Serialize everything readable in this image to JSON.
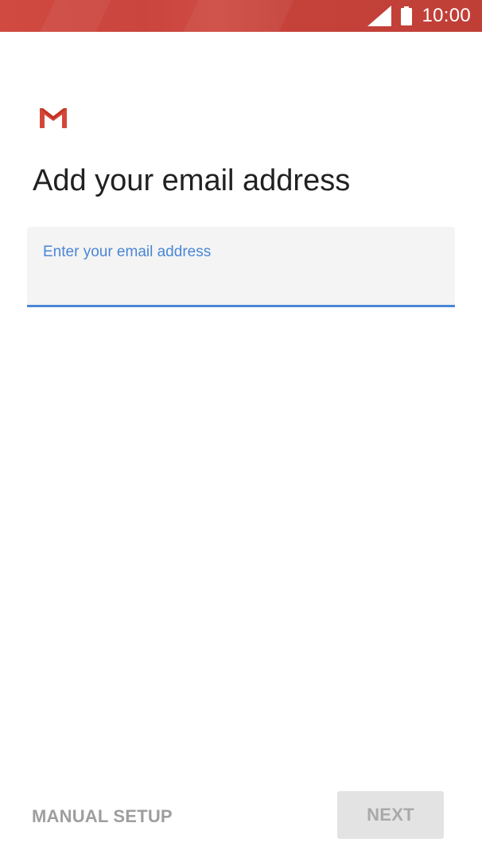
{
  "status_bar": {
    "time": "10:00",
    "background_color": "#c9453d",
    "icons": [
      "signal-icon",
      "battery-icon"
    ]
  },
  "app": {
    "logo_icon": "gmail-logo-icon",
    "brand_color": "#d44638"
  },
  "main": {
    "title": "Add your email address",
    "email_field": {
      "label": "Enter your email address",
      "value": "",
      "accent_color": "#4a86d6"
    }
  },
  "footer": {
    "manual_setup_label": "MANUAL SETUP",
    "next_label": "NEXT"
  }
}
